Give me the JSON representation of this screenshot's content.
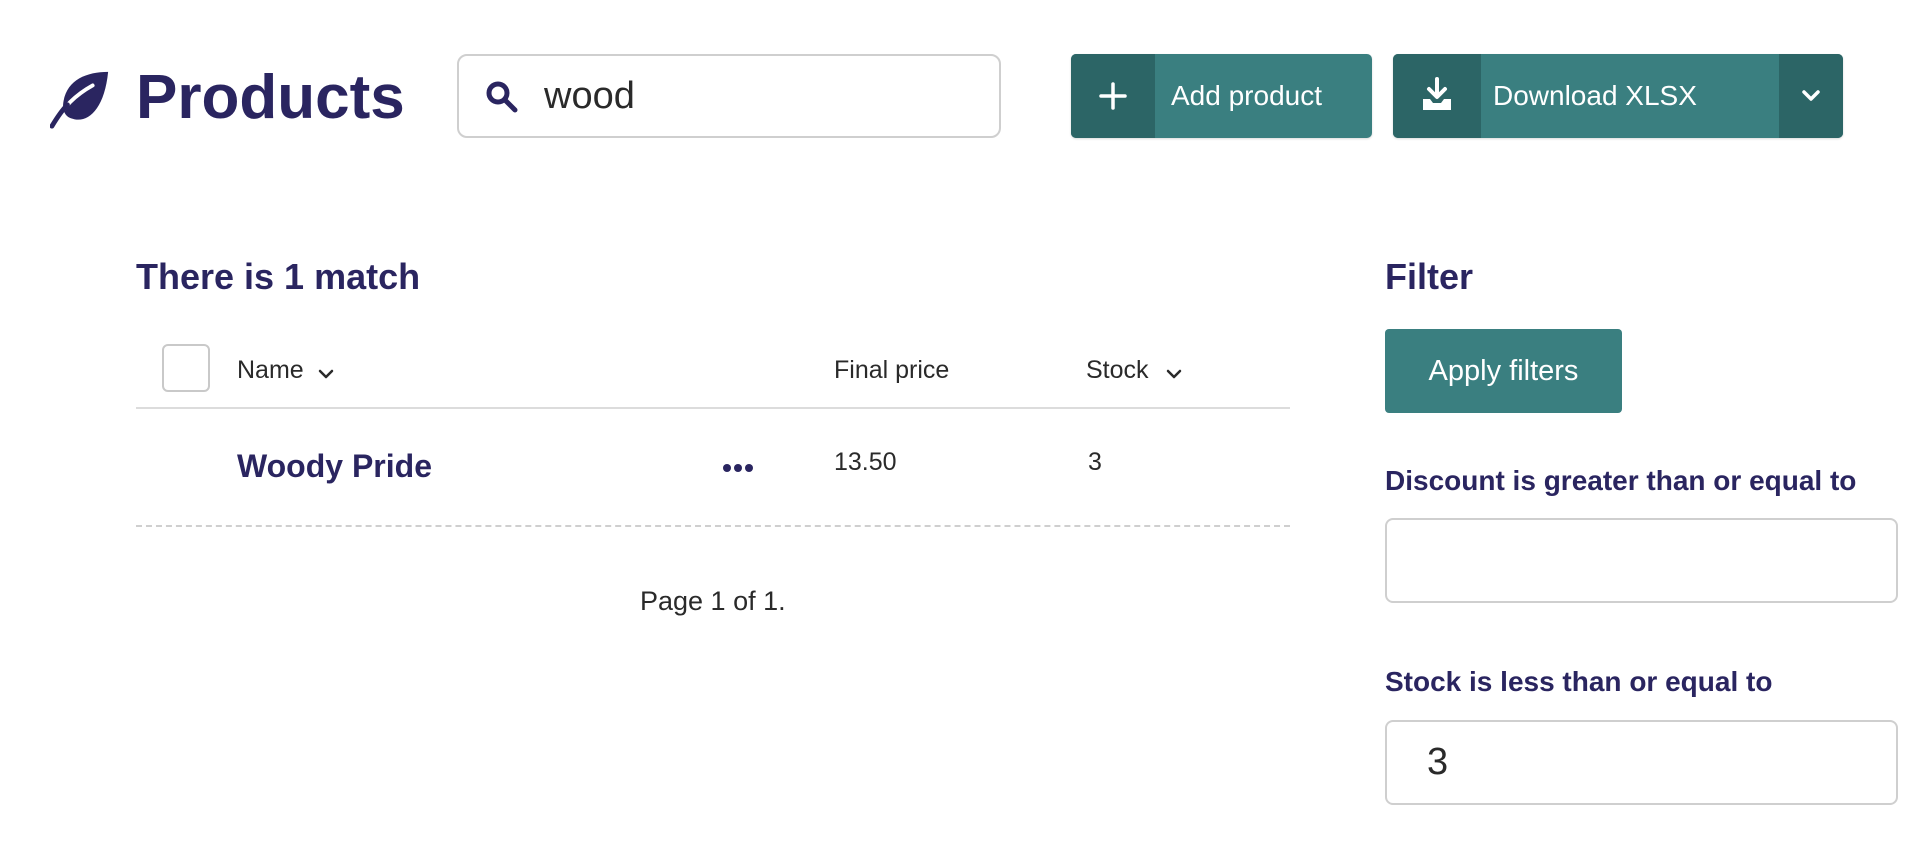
{
  "header": {
    "title": "Products",
    "logo_icon": "leaf-icon",
    "search": {
      "value": "wood",
      "icon": "search-icon"
    },
    "add_button": {
      "label": "Add product",
      "icon": "plus-icon"
    },
    "download_button": {
      "label": "Download XLSX",
      "icon": "download-icon",
      "menu_icon": "chevron-down-icon"
    }
  },
  "results": {
    "summary": "There is 1 match",
    "columns": {
      "name": "Name",
      "final_price": "Final price",
      "stock": "Stock"
    },
    "rows": [
      {
        "name": "Woody Pride",
        "final_price": "13.50",
        "stock": "3"
      }
    ],
    "pagination": "Page 1 of 1."
  },
  "filter": {
    "title": "Filter",
    "apply_label": "Apply filters",
    "discount_label": "Discount is greater than or equal to",
    "discount_value": "",
    "stock_label": "Stock is less than or equal to",
    "stock_value": "3"
  },
  "colors": {
    "primary_text": "#2a2560",
    "teal": "#3a7f80",
    "teal_dark": "#2c6566"
  }
}
